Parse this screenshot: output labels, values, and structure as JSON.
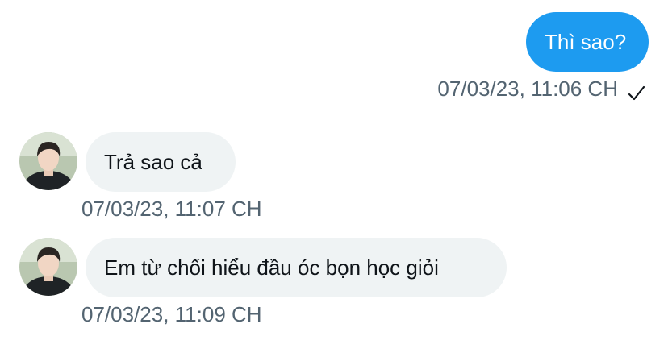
{
  "messages": [
    {
      "direction": "sent",
      "text": "Thì sao?",
      "time": "07/03/23, 11:06 CH",
      "status_icon": "checkmark-icon"
    },
    {
      "direction": "received",
      "text": "Trả sao cả",
      "time": "07/03/23, 11:07 CH",
      "avatar_icon": "profile-avatar"
    },
    {
      "direction": "received",
      "text": "Em từ chối hiểu đầu óc bọn học giỏi",
      "time": "07/03/23, 11:09 CH",
      "avatar_icon": "profile-avatar"
    }
  ],
  "colors": {
    "sent_bubble": "#1d9bf0",
    "received_bubble": "#eff3f4",
    "timestamp": "#536471",
    "text": "#0f1419"
  }
}
